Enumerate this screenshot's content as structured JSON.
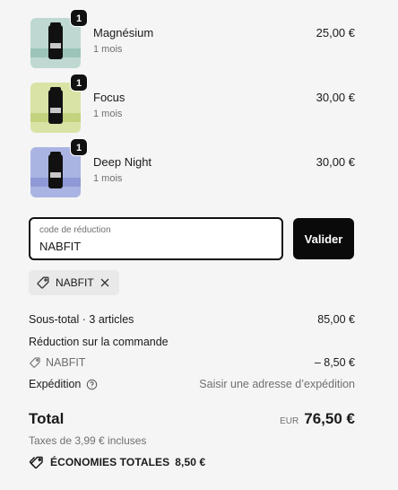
{
  "cart": {
    "items": [
      {
        "name": "Magnésium",
        "variant": "1 mois",
        "price": "25,00 €",
        "quantity": "1",
        "thumb_color": "#bfd9d2",
        "band_color": "#9cc4b9"
      },
      {
        "name": "Focus",
        "variant": "1 mois",
        "price": "30,00 €",
        "quantity": "1",
        "thumb_color": "#d9e3a6",
        "band_color": "#c3d27e"
      },
      {
        "name": "Deep Night",
        "variant": "1 mois",
        "price": "30,00 €",
        "quantity": "1",
        "thumb_color": "#aab4e3",
        "band_color": "#8e99d6"
      }
    ]
  },
  "discount": {
    "label": "code de réduction",
    "value": "NABFIT",
    "button_label": "Valider",
    "applied_code": "NABFIT"
  },
  "summary": {
    "subtotal_label": "Sous-total · 3 articles",
    "subtotal_value": "85,00 €",
    "order_discount_label": "Réduction sur la commande",
    "discount_code": "NABFIT",
    "discount_value": "– 8,50 €",
    "shipping_label": "Expédition",
    "shipping_value": "Saisir une adresse d’expédition",
    "total_label": "Total",
    "currency": "EUR",
    "total_value": "76,50 €",
    "taxes_text": "Taxes de 3,99 € incluses",
    "savings_label": "ÉCONOMIES TOTALES",
    "savings_value": "8,50 €"
  },
  "icons": {
    "tag": "tag-icon",
    "close": "close-icon",
    "help": "help-circle-icon"
  },
  "colors": {
    "background": "#f5f5f5",
    "primary": "#0a0a0a",
    "muted": "#707070"
  }
}
